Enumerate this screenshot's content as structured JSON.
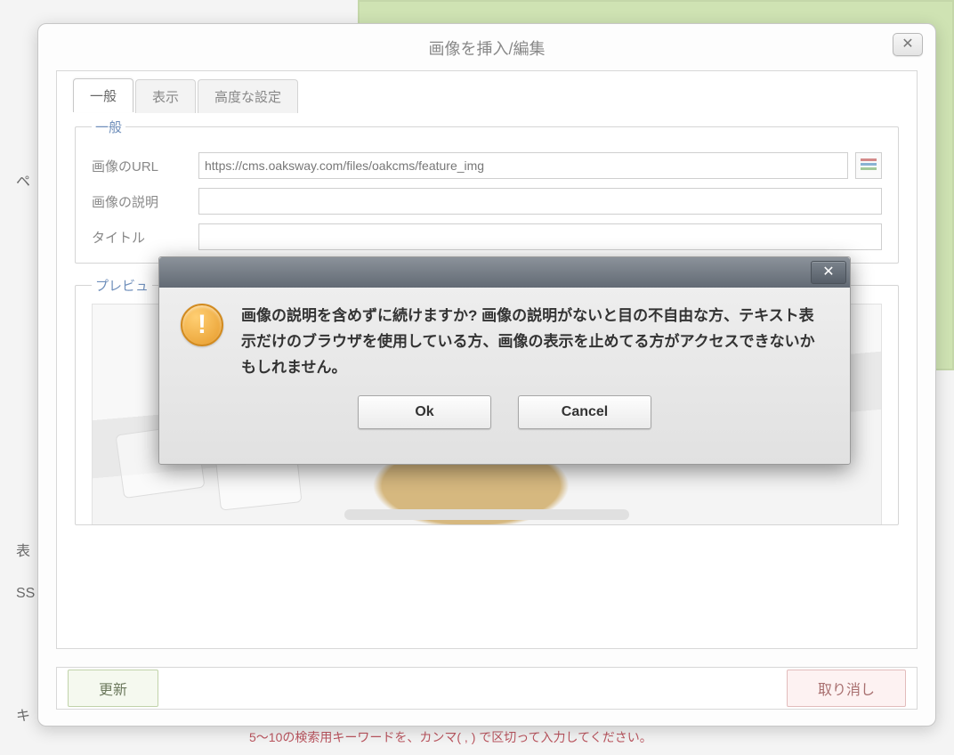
{
  "background": {
    "left_labels": [
      "ペ",
      "表",
      "SS",
      "キ"
    ],
    "bottom_hint": "5〜10の検索用キーワードを、カンマ( , ) で区切って入力してください。"
  },
  "dialog": {
    "title": "画像を挿入/編集",
    "tabs": {
      "general": "一般",
      "display": "表示",
      "advanced": "高度な設定"
    },
    "fieldset_label": "一般",
    "preview_label": "プレビュ",
    "fields": {
      "url": {
        "label": "画像のURL",
        "value": "https://cms.oaksway.com/files/oakcms/feature_img"
      },
      "alt": {
        "label": "画像の説明",
        "value": ""
      },
      "title": {
        "label": "タイトル",
        "value": ""
      }
    },
    "buttons": {
      "update": "更新",
      "cancel": "取り消し"
    }
  },
  "confirm": {
    "message": "画像の説明を含めずに続けますか? 画像の説明がないと目の不自由な方、テキスト表示だけのブラウザを使用している方、画像の表示を止めてる方がアクセスできないかもしれません。",
    "ok": "Ok",
    "cancel": "Cancel"
  }
}
